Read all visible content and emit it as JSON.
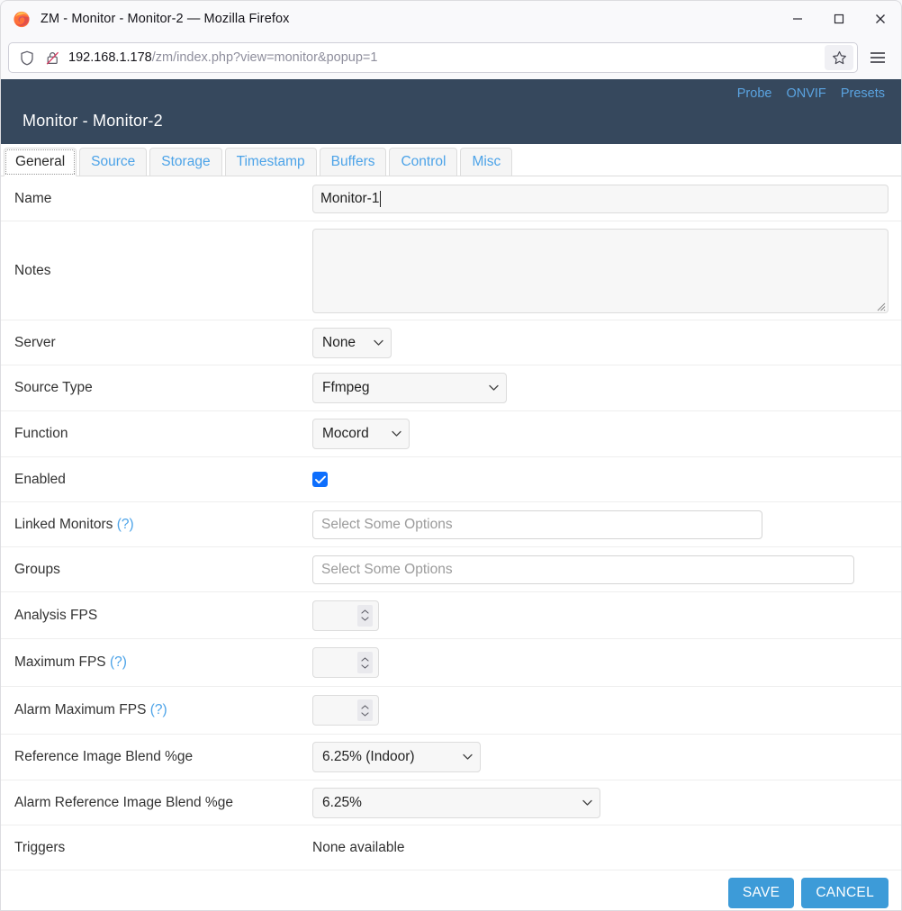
{
  "browser": {
    "window_title": "ZM - Monitor - Monitor-2 — Mozilla Firefox",
    "minimize_label": "−",
    "maximize_label": "□",
    "close_label": "×",
    "url_host": "192.168.1.178",
    "url_path": "/zm/index.php?view=monitor&popup=1",
    "shield_icon": "shield-icon",
    "insecure_icon": "lock-crossed-icon",
    "bookmark_icon": "star-icon",
    "menu_icon": "hamburger-menu-icon"
  },
  "header": {
    "title": "Monitor - Monitor-2",
    "links": [
      {
        "label": "Probe",
        "name": "probe-link"
      },
      {
        "label": "ONVIF",
        "name": "onvif-link"
      },
      {
        "label": "Presets",
        "name": "presets-link"
      }
    ],
    "link_color": "#5aa3e0",
    "bg_color": "#36485d"
  },
  "tabs": [
    {
      "label": "General",
      "active": true
    },
    {
      "label": "Source",
      "active": false
    },
    {
      "label": "Storage",
      "active": false
    },
    {
      "label": "Timestamp",
      "active": false
    },
    {
      "label": "Buffers",
      "active": false
    },
    {
      "label": "Control",
      "active": false
    },
    {
      "label": "Misc",
      "active": false
    }
  ],
  "form": {
    "name": {
      "label": "Name",
      "value": "Monitor-1"
    },
    "notes": {
      "label": "Notes",
      "value": ""
    },
    "server": {
      "label": "Server",
      "value": "None"
    },
    "source_type": {
      "label": "Source Type",
      "value": "Ffmpeg"
    },
    "function": {
      "label": "Function",
      "value": "Mocord"
    },
    "enabled": {
      "label": "Enabled",
      "checked": true
    },
    "linked_monitors": {
      "label": "Linked Monitors",
      "help": "(?)",
      "placeholder": "Select Some Options",
      "value": ""
    },
    "groups": {
      "label": "Groups",
      "placeholder": "Select Some Options",
      "value": ""
    },
    "analysis_fps": {
      "label": "Analysis FPS",
      "value": ""
    },
    "maximum_fps": {
      "label": "Maximum FPS",
      "help": "(?)",
      "value": ""
    },
    "alarm_maximum_fps": {
      "label": "Alarm Maximum FPS",
      "help": "(?)",
      "value": ""
    },
    "reference_blend": {
      "label": "Reference Image Blend %ge",
      "value": "6.25% (Indoor)"
    },
    "alarm_reference_blend": {
      "label": "Alarm Reference Image Blend %ge",
      "value": "6.25%"
    },
    "triggers": {
      "label": "Triggers",
      "value": "None available"
    }
  },
  "footer": {
    "save_label": "SAVE",
    "cancel_label": "CANCEL",
    "button_color": "#3d9bd8"
  }
}
